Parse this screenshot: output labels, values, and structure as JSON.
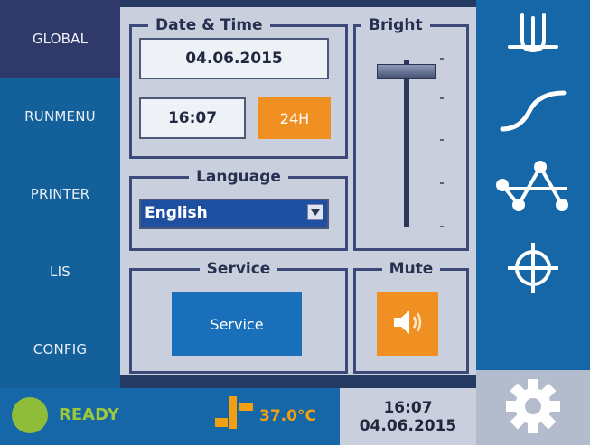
{
  "nav": {
    "items": [
      {
        "label": "GLOBAL",
        "active": true
      },
      {
        "label": "RUNMENU",
        "active": false
      },
      {
        "label": "PRINTER",
        "active": false
      },
      {
        "label": "LIS",
        "active": false
      },
      {
        "label": "CONFIG",
        "active": false
      }
    ]
  },
  "date_time": {
    "title": "Date & Time",
    "date": "04.06.2015",
    "time": "16:07",
    "format_button": "24H"
  },
  "brightness": {
    "title": "Bright",
    "level": 0.9
  },
  "language": {
    "title": "Language",
    "selected": "English"
  },
  "service": {
    "title": "Service",
    "button_label": "Service"
  },
  "mute": {
    "title": "Mute",
    "icon": "speaker-icon"
  },
  "right_icons": [
    "cuvette-icon",
    "curve-icon",
    "zigzag-icon",
    "crosshair-icon",
    "gear-icon"
  ],
  "status": {
    "state": "READY",
    "temperature": "37.0°C",
    "time": "16:07",
    "date": "04.06.2015"
  },
  "colors": {
    "nav_bg": "#14609b",
    "nav_active": "#2f3a6b",
    "accent_orange": "#f19022",
    "ready_green": "#8fbd3a",
    "panel": "#c9cfdd"
  }
}
